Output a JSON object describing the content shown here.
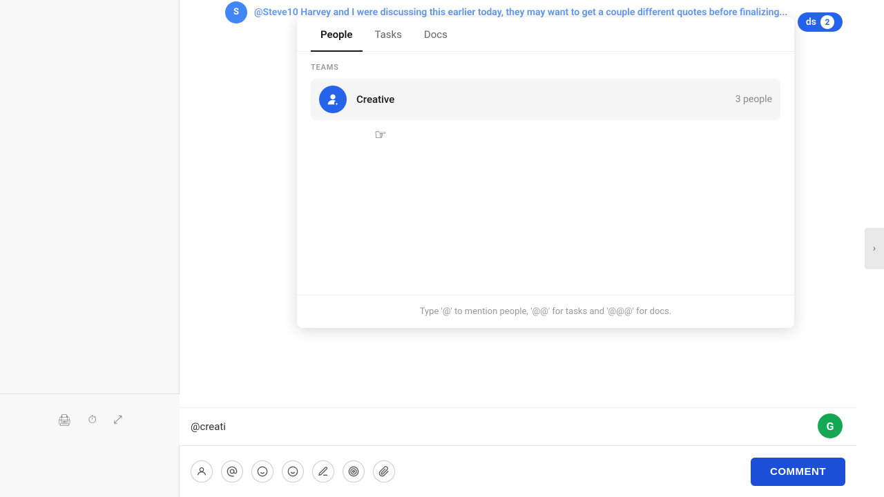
{
  "background": {
    "top_message": {
      "mention": "@Steve10",
      "text": " Harvey and I were discussing this earlier today, they may want to get a couple different quotes before finalizing..."
    },
    "notification": {
      "label": "ds",
      "count": "2"
    }
  },
  "dropdown": {
    "tabs": [
      {
        "id": "people",
        "label": "People",
        "active": true
      },
      {
        "id": "tasks",
        "label": "Tasks",
        "active": false
      },
      {
        "id": "docs",
        "label": "Docs",
        "active": false
      }
    ],
    "section_label": "TEAMS",
    "teams": [
      {
        "name": "Creative",
        "count": "3 people",
        "icon": "👤"
      }
    ],
    "hint": "Type '@' to mention people, '@@' for tasks and '@@@' for docs."
  },
  "input": {
    "value": "@creati"
  },
  "toolbar": {
    "icons": [
      {
        "id": "person",
        "symbol": "👤"
      },
      {
        "id": "at",
        "symbol": "@"
      },
      {
        "id": "slash",
        "symbol": "/"
      },
      {
        "id": "emoji",
        "symbol": "🙂"
      },
      {
        "id": "pen",
        "symbol": "✎"
      },
      {
        "id": "target",
        "symbol": "◎"
      },
      {
        "id": "clip",
        "symbol": "📎"
      }
    ],
    "comment_label": "COMMENT"
  },
  "left_icons": [
    {
      "id": "print",
      "symbol": "🖨"
    },
    {
      "id": "history",
      "symbol": "⏱"
    },
    {
      "id": "expand",
      "symbol": "⤢"
    }
  ]
}
